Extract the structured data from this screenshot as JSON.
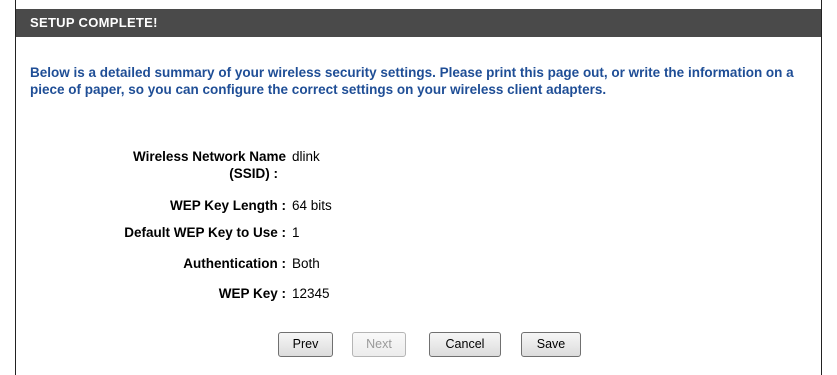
{
  "header": {
    "title": "SETUP COMPLETE!"
  },
  "intro": "Below is a detailed summary of your wireless security settings. Please print this page out, or write the information on a piece of paper, so you can configure the correct settings on your wireless client adapters.",
  "summary": [
    {
      "label_line1": "Wireless Network Name",
      "label_line2": "(SSID)  :",
      "value": "dlink"
    },
    {
      "label": "WEP Key Length :",
      "value": "64 bits"
    },
    {
      "label": "Default WEP Key to Use :",
      "value": "1"
    },
    {
      "label": "Authentication :",
      "value": "Both"
    },
    {
      "label": "WEP Key :",
      "value": "12345"
    }
  ],
  "buttons": {
    "prev": "Prev",
    "next": "Next",
    "cancel": "Cancel",
    "save": "Save"
  }
}
